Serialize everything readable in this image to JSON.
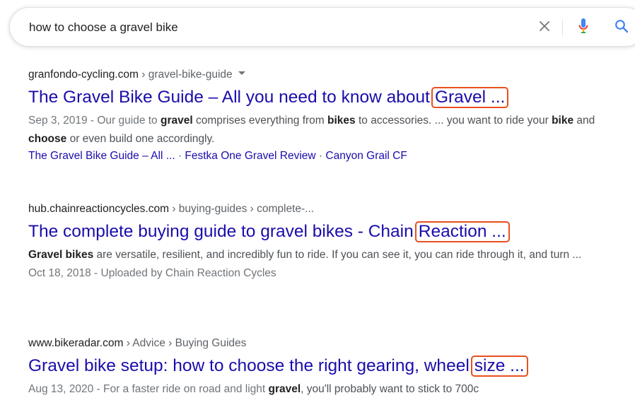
{
  "search": {
    "query": "how to choose a gravel bike"
  },
  "icons": {
    "clear": "close-icon",
    "mic": "microphone-icon",
    "search": "search-icon"
  },
  "colors": {
    "link": "#1a0dab",
    "highlight_box": "#e8501f",
    "snippet_text": "#4d5156",
    "mic_blue": "#4285f4",
    "mic_red": "#ea4335"
  },
  "results": [
    {
      "domain": "granfondo-cycling.com",
      "path": " › gravel-bike-guide",
      "title": "The Gravel Bike Guide – All you need to know about",
      "title_highlight": "Gravel ...",
      "snippet_parts": [
        "Sep 3, 2019 - Our guide to ",
        "gravel",
        " comprises everything from ",
        "bikes",
        " to accessories. ... you want to ride your ",
        "bike",
        " and ",
        "choose",
        " or even build one accordingly."
      ],
      "sitelinks": [
        "The Gravel Bike Guide – All ...",
        "Festka One Gravel Review",
        "Canyon Grail CF"
      ],
      "sitelink_separator": " · "
    },
    {
      "domain": "hub.chainreactioncycles.com",
      "path": " › buying-guides › complete-...",
      "title": "The complete buying guide to gravel bikes - Chain",
      "title_highlight": "Reaction ...",
      "snippet_parts": [
        "Gravel bikes",
        " are versatile, resilient, and incredibly fun to ride. If you can see it, you can ride through it, and turn ..."
      ],
      "meta": "Oct 18, 2018 - Uploaded by Chain Reaction Cycles"
    },
    {
      "domain": "www.bikeradar.com",
      "path": " › Advice › Buying Guides",
      "title": "Gravel bike setup: how to choose the right gearing, wheel",
      "title_highlight": "size ...",
      "snippet_parts": [
        "Aug 13, 2020 - For a faster ride on road and light ",
        "gravel",
        ", you'll probably want to stick to 700c"
      ]
    }
  ]
}
